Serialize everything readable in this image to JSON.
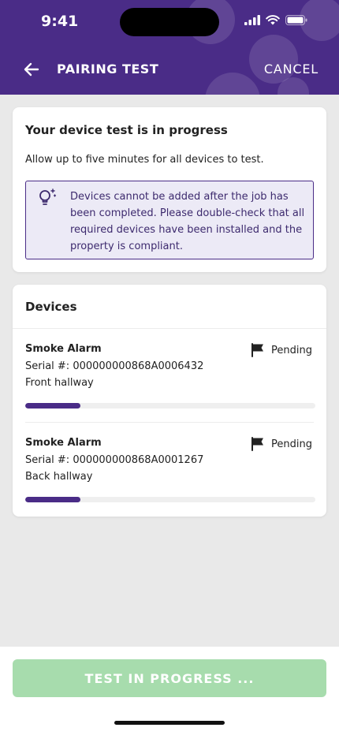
{
  "status_bar": {
    "time": "9:41"
  },
  "header": {
    "title": "PAIRING TEST",
    "cancel_label": "CANCEL"
  },
  "progress_card": {
    "title": "Your device test is in progress",
    "subtitle": "Allow up to five minutes for all devices to test.",
    "info": "Devices cannot be added after the job has been completed. Please double-check that all required devices have been installed and the property is compliant."
  },
  "devices_card": {
    "title": "Devices",
    "items": [
      {
        "name": "Smoke Alarm",
        "serial": "Serial #: 000000000868A0006432",
        "location": "Front hallway",
        "status": "Pending",
        "progress": 0.19
      },
      {
        "name": "Smoke Alarm",
        "serial": "Serial #: 000000000868A0001267",
        "location": "Back hallway",
        "status": "Pending",
        "progress": 0.19
      }
    ]
  },
  "footer": {
    "button_label": "TEST IN PROGRESS ..."
  },
  "colors": {
    "brand": "#4a2c87",
    "cta": "#a7dcad",
    "info_bg": "#eceaf6"
  }
}
